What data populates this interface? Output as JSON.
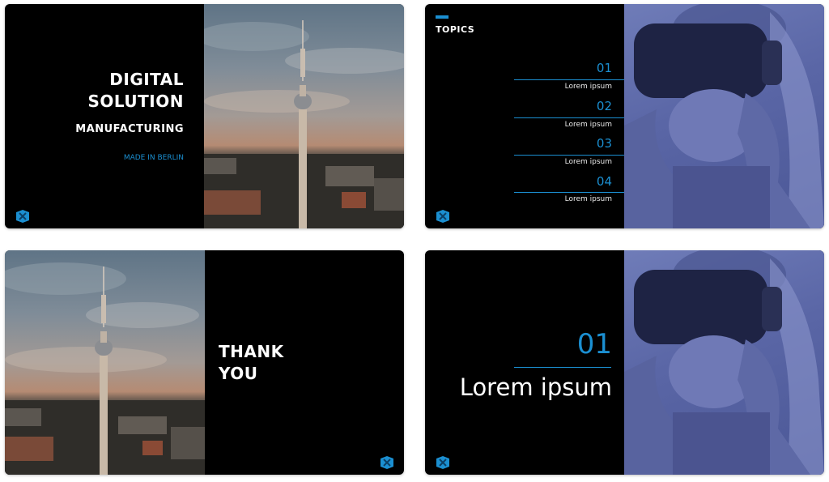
{
  "slide1": {
    "title_line1": "DIGITAL",
    "title_line2": "SOLUTION",
    "subtitle": "MANUFACTURING",
    "tagline": "MADE IN BERLIN"
  },
  "slide2": {
    "heading": "TOPICS",
    "topics": [
      {
        "num": "01",
        "label": "Lorem ipsum"
      },
      {
        "num": "02",
        "label": "Lorem ipsum"
      },
      {
        "num": "03",
        "label": "Lorem ipsum"
      },
      {
        "num": "04",
        "label": "Lorem ipsum"
      }
    ]
  },
  "slide3": {
    "line1": "THANK",
    "line2": "YOU"
  },
  "slide4": {
    "number": "01",
    "title": "Lorem ipsum"
  },
  "colors": {
    "accent": "#1b8fd1",
    "slide_background": "#000000",
    "photo_tint": "#5a66a6"
  },
  "icons": {
    "logo": "logo-icon"
  }
}
